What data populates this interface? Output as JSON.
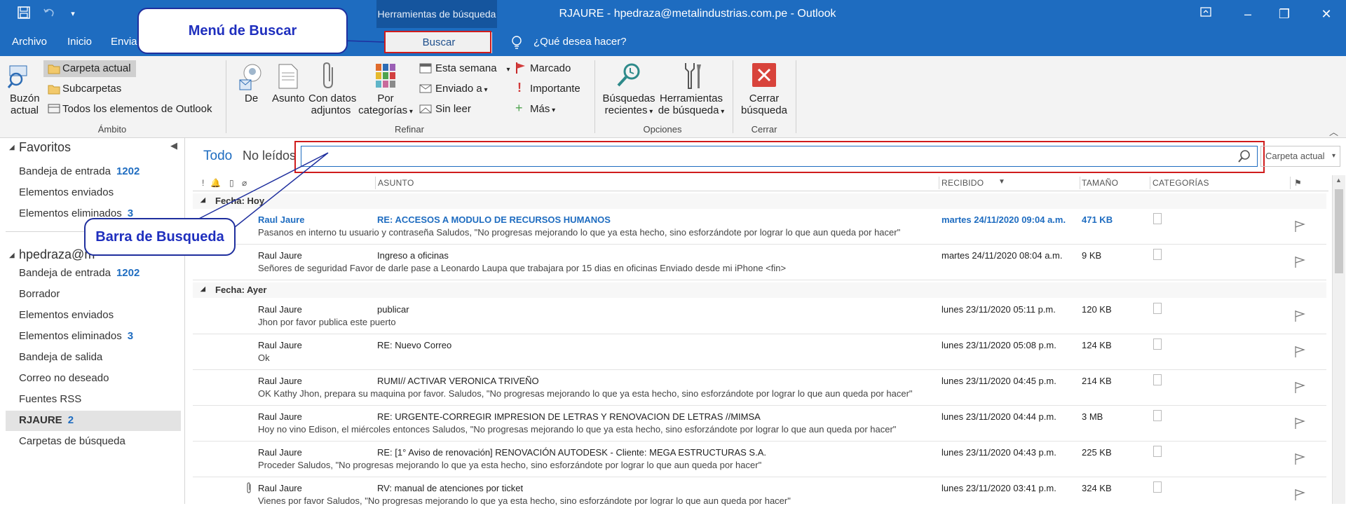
{
  "titlebar": {
    "contextual_tab": "Herramientas de búsqueda",
    "window_title": "RJAURE - hpedraza@metalindustrias.com.pe  -  Outlook",
    "qat": {
      "save_icon": "save-icon",
      "undo_icon": "undo-icon",
      "customize_icon": "customize-icon"
    },
    "controls": {
      "restore_ribbon": "▢",
      "restore": "❐",
      "minimize": "–",
      "close": "✕"
    }
  },
  "menu": {
    "items": [
      "Archivo",
      "Inicio",
      "Envia"
    ],
    "buscar_tab": "Buscar",
    "tell_me": "¿Qué desea hacer?"
  },
  "ribbon": {
    "ambito": {
      "label": "Ámbito",
      "buzon_line1": "Buzón",
      "buzon_line2": "actual",
      "carpeta_actual": "Carpeta actual",
      "subcarpetas": "Subcarpetas",
      "todos": "Todos los elementos de Outlook"
    },
    "refinar": {
      "label": "Refinar",
      "de": "De",
      "asunto": "Asunto",
      "adjuntos_line1": "Con datos",
      "adjuntos_line2": "adjuntos",
      "categorias_line1": "Por",
      "categorias_line2": "categorías",
      "esta_semana": "Esta semana",
      "enviado_a": "Enviado a",
      "sin_leer": "Sin leer",
      "marcado": "Marcado",
      "importante": "Importante",
      "mas": "Más"
    },
    "opciones": {
      "label": "Opciones",
      "recientes_line1": "Búsquedas",
      "recientes_line2": "recientes",
      "herramientas_line1": "Herramientas",
      "herramientas_line2": "de búsqueda"
    },
    "cerrar": {
      "label": "Cerrar",
      "cerrar_line1": "Cerrar",
      "cerrar_line2": "búsqueda"
    }
  },
  "nav": {
    "favoritos": "Favoritos",
    "fav_items": [
      {
        "label": "Bandeja de entrada",
        "count": "1202"
      },
      {
        "label": "Elementos enviados",
        "count": ""
      },
      {
        "label": "Elementos eliminados",
        "count": "3"
      }
    ],
    "account": "hpedraza@m",
    "account_items": [
      {
        "label": "Bandeja de entrada",
        "count": "1202"
      },
      {
        "label": "Borrador",
        "count": ""
      },
      {
        "label": "Elementos enviados",
        "count": ""
      },
      {
        "label": "Elementos eliminados",
        "count": "3"
      },
      {
        "label": "Bandeja de salida",
        "count": ""
      },
      {
        "label": "Correo no deseado",
        "count": ""
      },
      {
        "label": "Fuentes RSS",
        "count": ""
      },
      {
        "label": "RJAURE",
        "count": "2"
      },
      {
        "label": "Carpetas de búsqueda",
        "count": ""
      }
    ]
  },
  "search": {
    "filter_all": "Todo",
    "filter_unread": "No leídos",
    "placeholder": "",
    "scope": "Carpeta actual"
  },
  "columns": {
    "asunto": "ASUNTO",
    "recibido": "RECIBIDO",
    "tamano": "TAMAÑO",
    "categorias": "CATEGORÍAS"
  },
  "groups": [
    {
      "label": "Fecha: Hoy",
      "rows": [
        {
          "from": "Raul Jaure",
          "subject": "RE: ACCESOS A MODULO DE RECURSOS HUMANOS",
          "preview": "Pasanos en interno tu usuario y contraseña  Saludos,  \"No progresas mejorando lo que ya esta hecho, sino esforzándote por lograr lo que aun queda por hacer\"",
          "received": "martes 24/11/2020 09:04 a.m.",
          "size": "471 KB",
          "unread": true
        },
        {
          "from": "Raul Jaure",
          "subject": "Ingreso a oficinas",
          "preview": "Señores de seguridad  Favor de darle pase a Leonardo Laupa que trabajara por 15 dias en oficinas  Enviado desde mi iPhone <fin>",
          "received": "martes 24/11/2020 08:04 a.m.",
          "size": "9 KB",
          "unread": false
        }
      ]
    },
    {
      "label": "Fecha: Ayer",
      "rows": [
        {
          "from": "Raul Jaure",
          "subject": "publicar",
          "preview": "Jhon por favor publica este puerto",
          "received": "lunes 23/11/2020 05:11 p.m.",
          "size": "120 KB",
          "unread": false
        },
        {
          "from": "Raul Jaure",
          "subject": "RE: Nuevo Correo",
          "preview": "Ok",
          "received": "lunes 23/11/2020 05:08 p.m.",
          "size": "124 KB",
          "unread": false
        },
        {
          "from": "Raul Jaure",
          "subject": "RUMI// ACTIVAR VERONICA TRIVEÑO",
          "preview": "OK Kathy  Jhon, prepara su maquina por favor.  Saludos,  \"No progresas mejorando lo que ya esta hecho, sino esforzándote por lograr lo que aun queda por hacer\"",
          "received": "lunes 23/11/2020 04:45 p.m.",
          "size": "214 KB",
          "unread": false
        },
        {
          "from": "Raul Jaure",
          "subject": "RE: URGENTE-CORREGIR IMPRESION DE LETRAS Y RENOVACION DE LETRAS //MIMSA",
          "preview": "Hoy no vino Edison, el miércoles entonces  Saludos,  \"No progresas mejorando lo que ya esta hecho, sino esforzándote por lograr lo que aun queda por hacer\"",
          "received": "lunes 23/11/2020 04:44 p.m.",
          "size": "3 MB",
          "unread": false
        },
        {
          "from": "Raul Jaure",
          "subject": "RE: [1° Aviso de renovación] RENOVACIÓN AUTODESK - Cliente: MEGA ESTRUCTURAS S.A.",
          "preview": "Proceder  Saludos,  \"No progresas mejorando lo que ya esta hecho, sino esforzándote por lograr lo que aun queda por hacer\"",
          "received": "lunes 23/11/2020 04:43 p.m.",
          "size": "225 KB",
          "unread": false
        },
        {
          "from": "Raul Jaure",
          "subject": "RV: manual de atenciones por ticket",
          "preview": "Vienes por favor  Saludos,  \"No progresas mejorando lo que ya esta hecho, sino esforzándote por lograr lo que aun queda por hacer\"",
          "received": "lunes 23/11/2020 03:41 p.m.",
          "size": "324 KB",
          "unread": false
        }
      ]
    }
  ],
  "callouts": {
    "menu": "Menú de Buscar",
    "bar": "Barra de Busqueda"
  },
  "colors": {
    "accent": "#1e6cc0",
    "highlight": "#d01c1c",
    "callout": "#1f2fbe"
  }
}
